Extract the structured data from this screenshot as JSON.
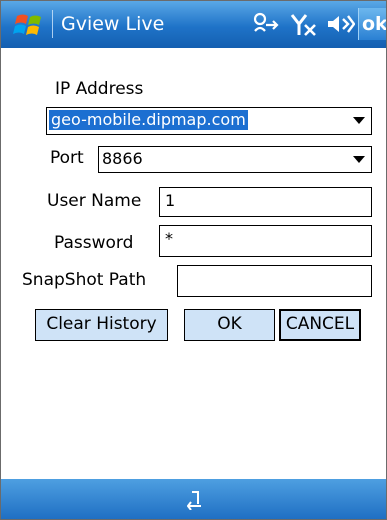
{
  "titlebar": {
    "app_title": "Gview Live",
    "ok_label": "ok",
    "icons": [
      "windows-start-icon",
      "connectivity-icon",
      "signal-off-icon",
      "volume-icon"
    ]
  },
  "form": {
    "ip_label": "IP Address",
    "ip_value": "geo-mobile.dipmap.com",
    "port_label": "Port",
    "port_value": "8866",
    "username_label": "User Name",
    "username_value": "1",
    "password_label": "Password",
    "password_value": "*",
    "snapshot_label": "SnapShot Path",
    "snapshot_value": ""
  },
  "buttons": {
    "clear_history": "Clear History",
    "ok": "OK",
    "cancel": "CANCEL"
  },
  "bottombar": {
    "icons": [
      "keyboard-icon"
    ]
  },
  "colors": {
    "titlebar": "#1f73c8",
    "button_face": "#cfe3f7",
    "selection": "#1c6fd1"
  }
}
